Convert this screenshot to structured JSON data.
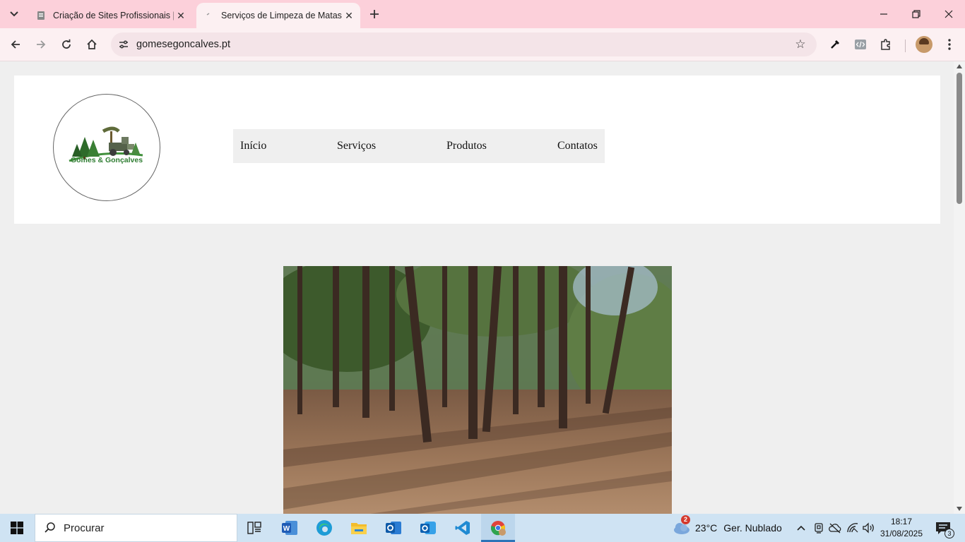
{
  "browser": {
    "tabs": [
      {
        "title": "Criação de Sites Profissionais | D",
        "active": false
      },
      {
        "title": "Serviços de Limpeza de Matas e",
        "active": true
      }
    ],
    "address_bar": {
      "url": "gomesegoncalves.pt"
    }
  },
  "site": {
    "logo_text": "Gomes & Gonçalves",
    "nav": [
      "Início",
      "Serviços",
      "Produtos",
      "Contatos"
    ]
  },
  "taskbar": {
    "search_label": "Procurar",
    "weather": {
      "temperature": "23°C",
      "condition": "Ger. Nublado",
      "badge": "2"
    },
    "clock": {
      "time": "18:17",
      "date": "31/08/2025"
    },
    "notification_count": "3"
  },
  "colors": {
    "tabstrip": "#fcd0da",
    "toolbar": "#fcf0f2",
    "page_background": "#efefef",
    "logo_green": "#2f7d32",
    "taskbar": "#cfe3f3"
  }
}
